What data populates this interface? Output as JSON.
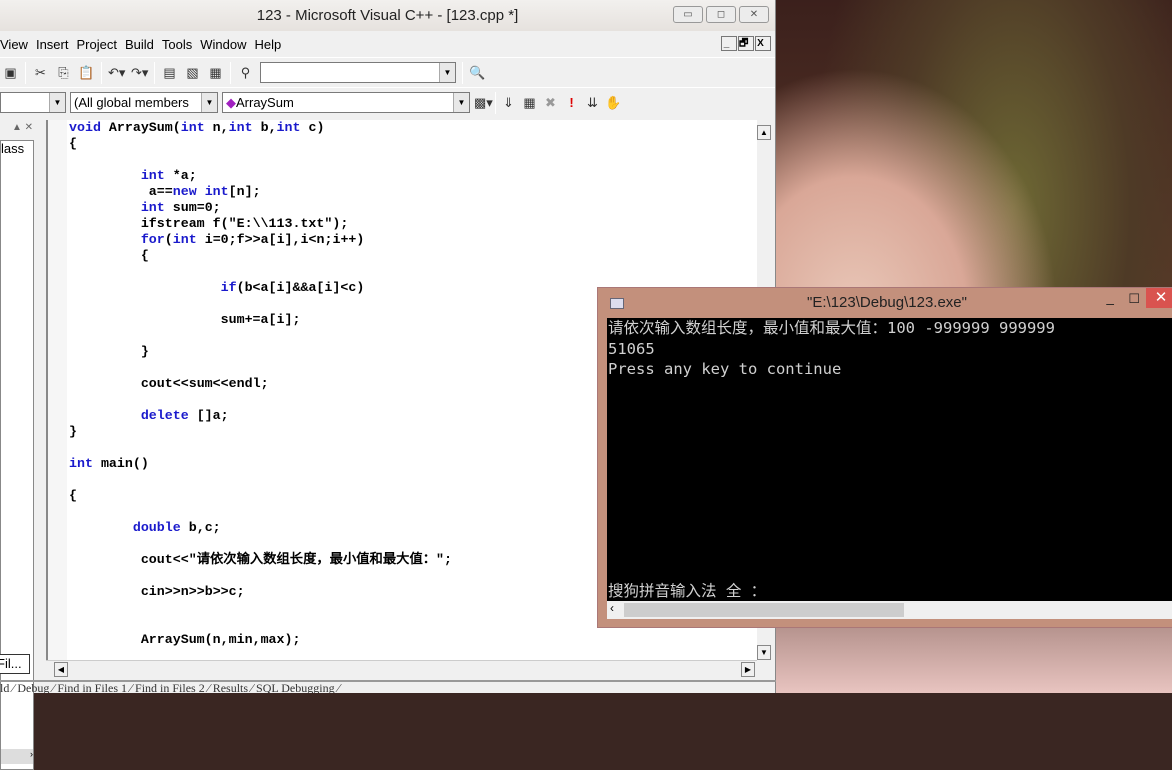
{
  "ide": {
    "title": "123 - Microsoft Visual C++ - [123.cpp *]",
    "window_buttons": [
      "▭",
      "◻",
      "✕"
    ],
    "menu": [
      "View",
      "Insert",
      "Project",
      "Build",
      "Tools",
      "Window",
      "Help"
    ],
    "mdi_buttons": [
      "_",
      "🗗",
      "X"
    ],
    "class_combo": "",
    "members_combo": "(All global members",
    "function_combo": "ArraySum",
    "find_combo": "",
    "workspace_label": "lass",
    "workspace_tab": "Fil...",
    "code": [
      "void ArraySum(int n,int b,int c)",
      "{",
      "",
      "         int *a;",
      "          a==new int[n];",
      "         int sum=0;",
      "         ifstream f(\"E:\\\\113.txt\");",
      "         for(int i=0;f>>a[i],i<n;i++)",
      "         {",
      "",
      "                   if(b<a[i]&&a[i]<c)",
      "",
      "                   sum+=a[i];",
      "",
      "         }",
      "",
      "         cout<<sum<<endl;",
      "",
      "         delete []a;",
      "}",
      "",
      "int main()",
      "",
      "{",
      "",
      "        double b,c;",
      "",
      "         cout<<\"请依次输入数组长度，最小值和最大值：\";",
      "",
      "         cin>>n>>b>>c;",
      "",
      "",
      "         ArraySum(n,min,max);"
    ],
    "keywords": [
      "void",
      "int",
      "new",
      "for",
      "if",
      "double",
      "delete"
    ],
    "output_tabs": "ld ∕ Debug ∕ Find in Files 1 ∕ Find in Files 2 ∕ Results ∕ SQL Debugging ∕"
  },
  "console": {
    "title": "\"E:\\123\\Debug\\123.exe\"",
    "lines": [
      "请依次输入数组长度，最小值和最大值：100 -999999 999999",
      "51065",
      "Press any key to continue"
    ],
    "ime_status": "搜狗拼音输入法 全 ："
  },
  "colors": {
    "keyword": "#1a1acc",
    "console_frame": "#c3907c",
    "close_button": "#d9534f"
  }
}
